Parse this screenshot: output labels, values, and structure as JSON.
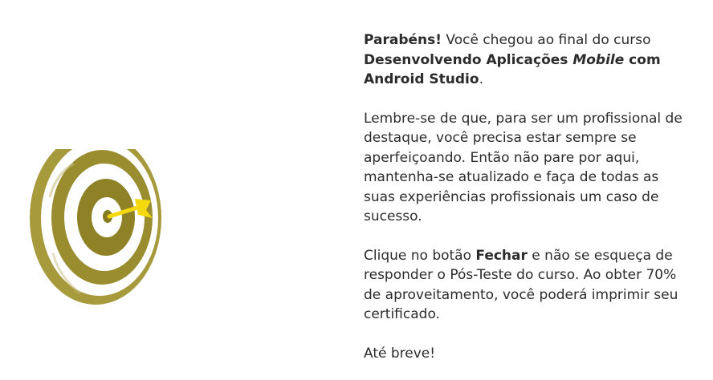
{
  "illustration": {
    "icon": "dartboard-target-icon",
    "colors": {
      "ring": "#a79a3c",
      "ring_dark": "#857a22",
      "ring_light": "#bdb06a",
      "dart": "#f5d90f"
    }
  },
  "message": {
    "p1": {
      "bold_lead": "Parabéns!",
      "text_1": " Você chegou ao final do curso ",
      "course_part_1": "Desenvolvendo Aplicações ",
      "course_italic": "Mobile",
      "course_part_2": " com Android Studio",
      "end": "."
    },
    "p2": "Lembre-se de que, para ser um profissional de destaque, você precisa estar sempre se aperfeiçoando. Então não pare por aqui, mantenha-se atualizado e faça de todas as suas experiências profissionais um caso de sucesso.",
    "p3": {
      "text_1": "Clique no botão ",
      "bold_button": "Fechar",
      "text_2": " e não se esqueça de responder o Pós-Teste do curso. Ao obter 70% de aproveitamento, você poderá imprimir seu certificado."
    },
    "p4": "Até breve!"
  }
}
